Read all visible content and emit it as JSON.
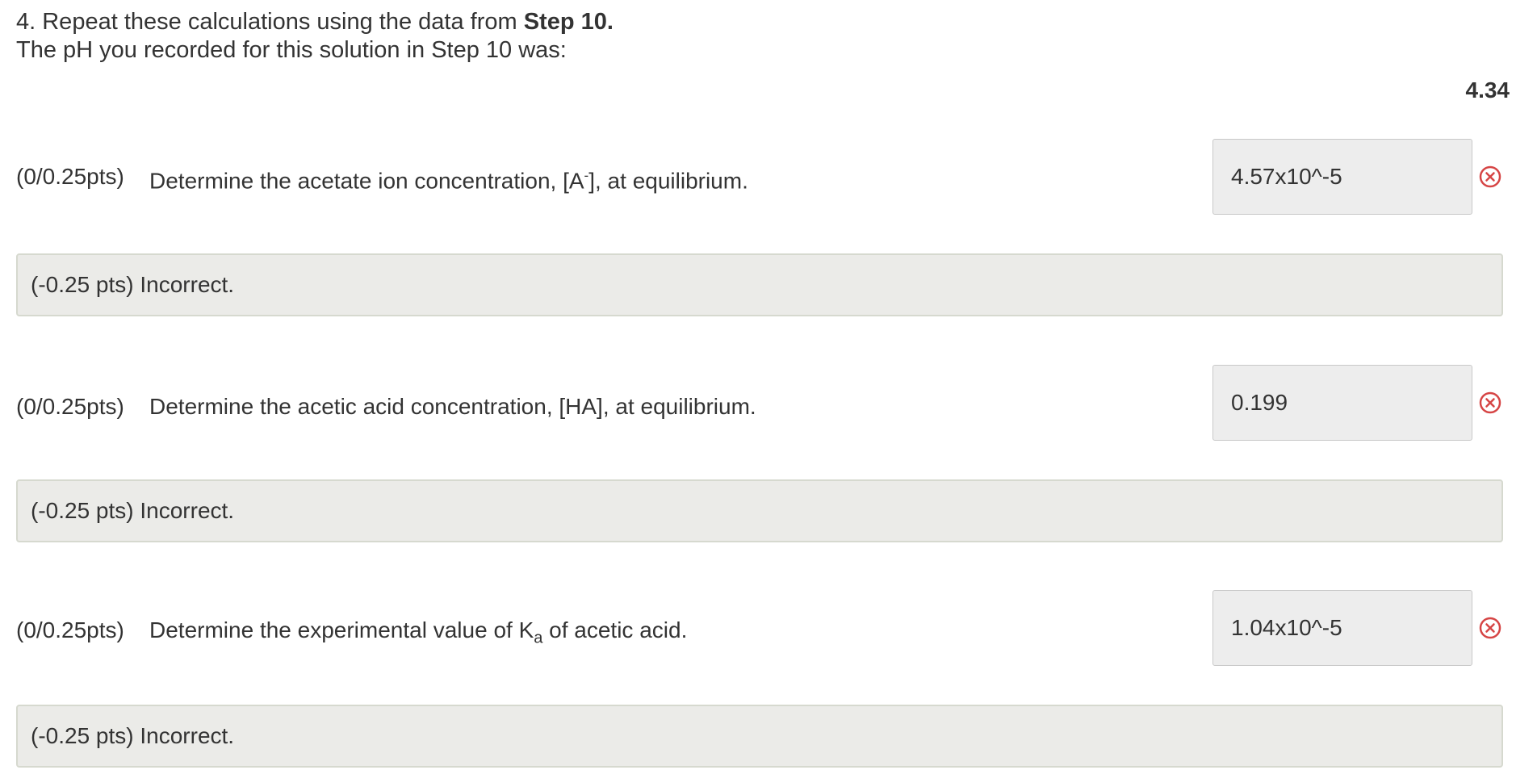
{
  "header": {
    "line1_prefix": "4. Repeat these calculations using the data from ",
    "line1_bold": "Step 10.",
    "line2": "The pH you recorded for this solution in Step 10 was:",
    "ph_value": "4.34"
  },
  "questions": [
    {
      "points": "(0/0.25pts)",
      "text_before": "Determine the acetate ion concentration, [A",
      "superscript": "-",
      "text_after": "], at equilibrium.",
      "answer": "4.57x10^-5",
      "feedback": "(-0.25 pts) Incorrect."
    },
    {
      "points": "(0/0.25pts)",
      "text": "Determine the acetic acid concentration, [HA], at equilibrium.",
      "answer": "0.199",
      "feedback": "(-0.25 pts) Incorrect."
    },
    {
      "points": "(0/0.25pts)",
      "text_before": "Determine the experimental value of K",
      "subscript": "a",
      "text_after": " of acetic acid.",
      "answer": "1.04x10^-5",
      "feedback": "(-0.25 pts) Incorrect."
    }
  ],
  "colors": {
    "incorrect_icon": "#d64545",
    "answer_bg": "#ededed",
    "feedback_bg": "#ebebe8"
  },
  "icons": {
    "status": "incorrect-circle-x-icon"
  }
}
